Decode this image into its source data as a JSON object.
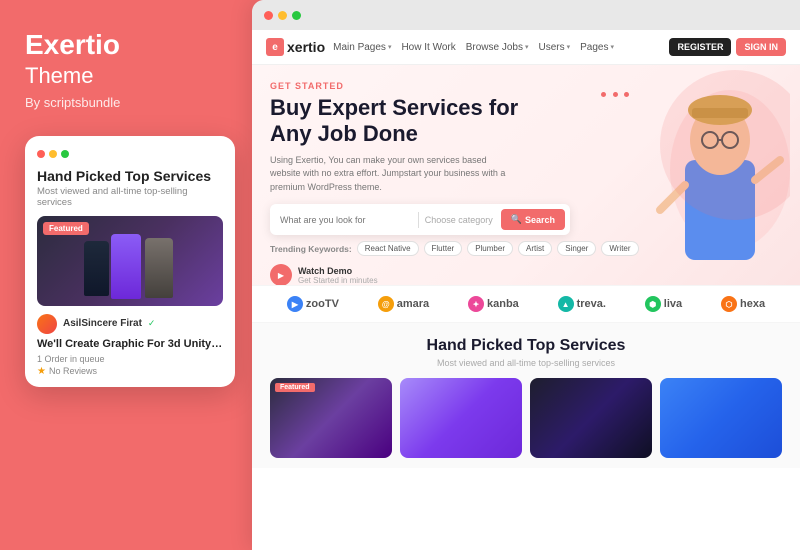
{
  "brand": {
    "title": "Exertio",
    "subtitle": "Theme",
    "by": "By scriptsbundle"
  },
  "mobile_card": {
    "dots": [
      "red",
      "yellow",
      "green"
    ],
    "title": "Hand Picked Top Services",
    "subtitle": "Most viewed and all-time top-selling services",
    "featured_badge": "Featured",
    "username": "AsilSincere Firat",
    "verified": "✓",
    "service_title": "We'll Create Graphic For 3d Unity ...",
    "orders": "1 Order in queue",
    "reviews": "No Reviews"
  },
  "browser": {
    "dots": [
      "red",
      "yellow",
      "green"
    ]
  },
  "nav": {
    "logo": "exertio",
    "logo_prefix": "e",
    "links": [
      {
        "label": "Main Pages",
        "has_chevron": true
      },
      {
        "label": "How It Work",
        "has_chevron": false
      },
      {
        "label": "Browse Jobs",
        "has_chevron": true
      },
      {
        "label": "Users",
        "has_chevron": true
      },
      {
        "label": "Pages",
        "has_chevron": true
      }
    ],
    "register": "REGISTER",
    "signin": "SIGN IN"
  },
  "hero": {
    "tag": "GET STARTED",
    "title": "Buy Expert Services for Any Job Done",
    "description": "Using Exertio, You can make your own services based website with no extra effort. Jumpstart your business with a premium WordPress theme.",
    "search_placeholder": "What are you look for",
    "category_placeholder": "Choose category",
    "search_button": "Search",
    "trending_label": "Trending Keywords:",
    "trending_tags": [
      "React Native",
      "Flutter",
      "Plumber",
      "Artist",
      "Singer",
      "Writer"
    ],
    "watch_label": "Watch Demo",
    "watch_sub": "Get Started in minutes"
  },
  "partners": [
    {
      "name": "zooTV",
      "icon": "z"
    },
    {
      "name": "amara",
      "icon": "a"
    },
    {
      "name": "kanba",
      "icon": "k"
    },
    {
      "name": "treva.",
      "icon": "t"
    },
    {
      "name": "liva",
      "icon": "l"
    },
    {
      "name": "hexa",
      "icon": "h"
    }
  ],
  "services_section": {
    "title": "Hand Picked Top Services",
    "subtitle": "Most viewed and all-time top-selling services",
    "cards": [
      {
        "featured": true
      },
      {
        "featured": false
      },
      {
        "featured": false
      },
      {
        "featured": false
      }
    ]
  }
}
